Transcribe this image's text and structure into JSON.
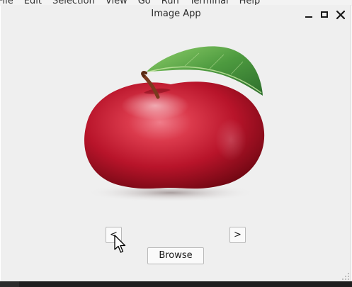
{
  "menubar": {
    "items": [
      "File",
      "Edit",
      "Selection",
      "View",
      "Go",
      "Run",
      "Terminal",
      "Help"
    ]
  },
  "window": {
    "title": "Image App",
    "controls": {
      "minimize_icon": "minimize-icon",
      "maximize_icon": "maximize-icon",
      "close_icon": "close-icon"
    }
  },
  "image": {
    "subject": "red apple with leaf",
    "icon": "apple-image"
  },
  "nav": {
    "prev_label": "<",
    "next_label": ">"
  },
  "actions": {
    "browse_label": "Browse"
  },
  "colors": {
    "window_bg": "#efefef",
    "apple_red": "#c0182b",
    "leaf_green": "#5aa04a"
  }
}
